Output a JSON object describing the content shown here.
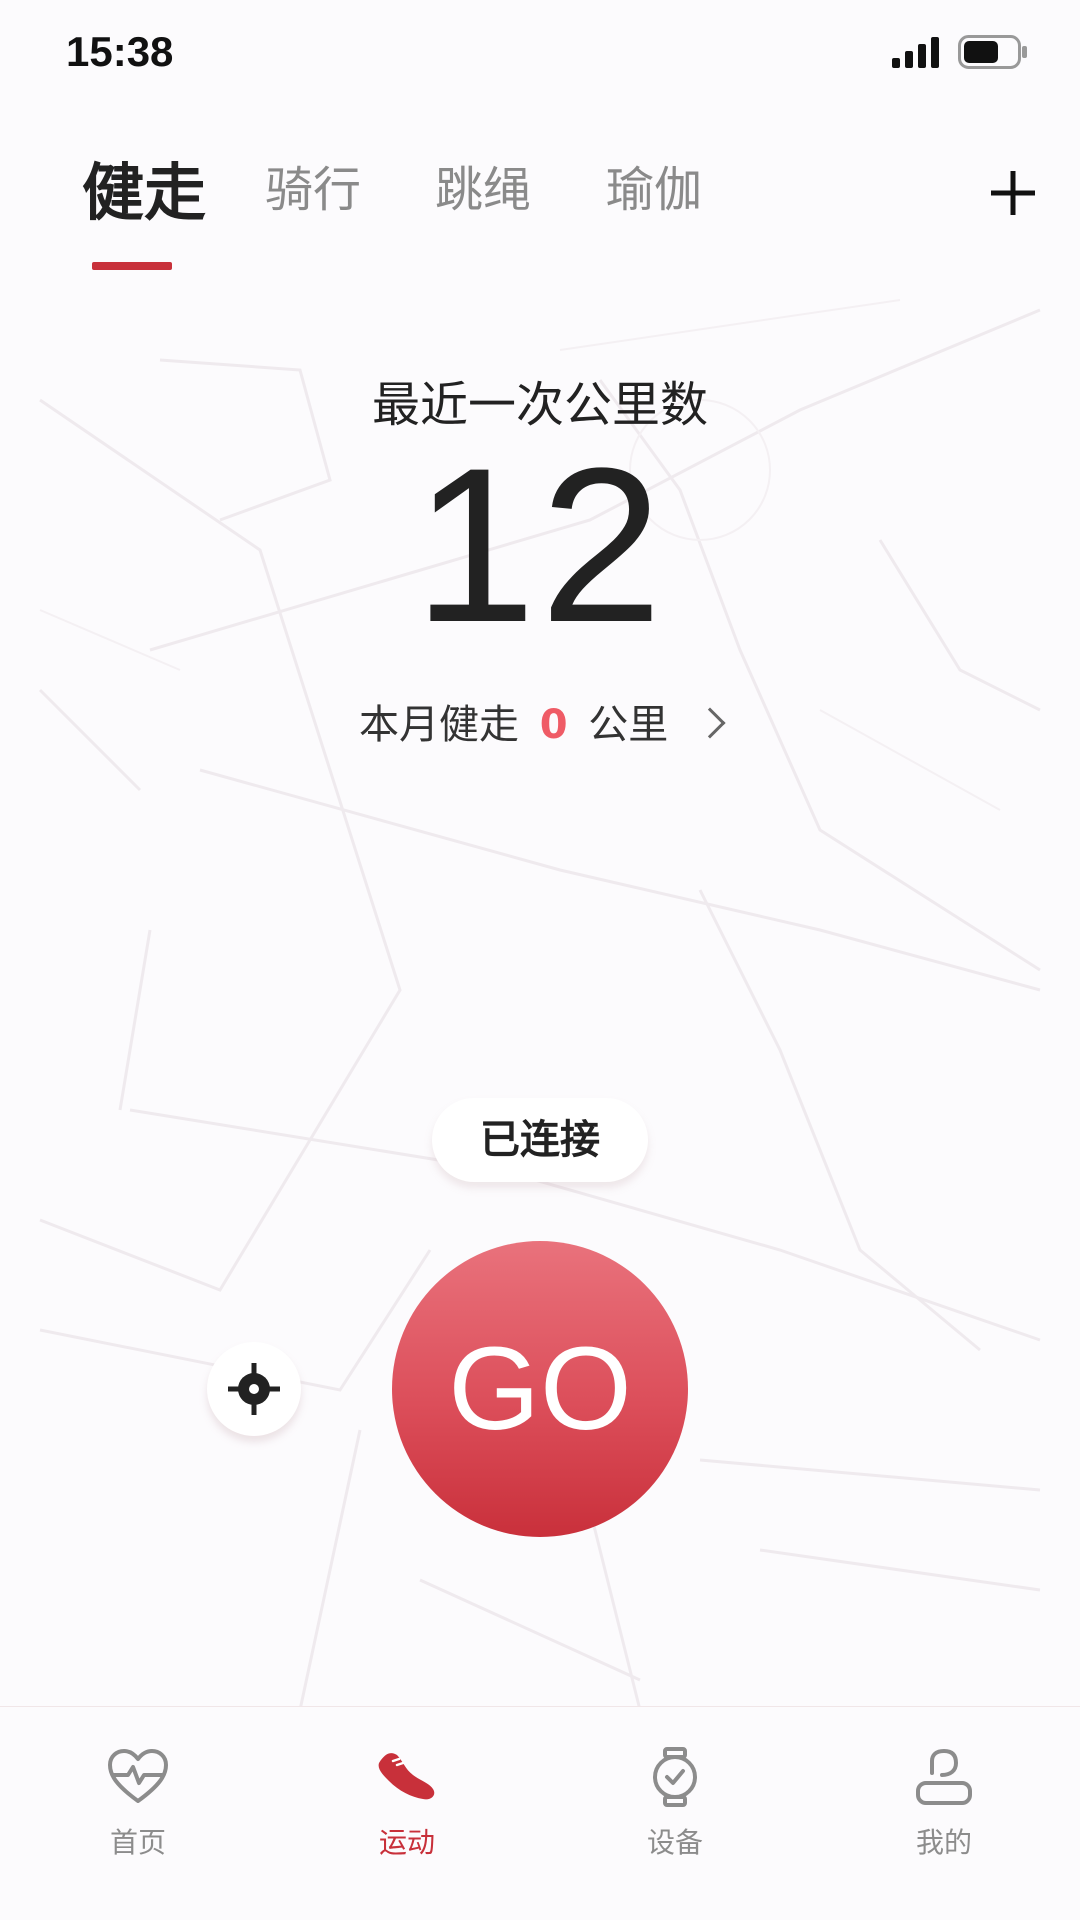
{
  "status_bar": {
    "time": "15:38"
  },
  "tabs": [
    {
      "label": "健走",
      "active": true
    },
    {
      "label": "骑行",
      "active": false
    },
    {
      "label": "跳绳",
      "active": false
    },
    {
      "label": "瑜伽",
      "active": false
    }
  ],
  "add_icon": "plus-icon",
  "summary": {
    "title": "最近一次公里数",
    "value": "12",
    "month_prefix": "本月健走",
    "month_value": "0",
    "month_unit": "公里"
  },
  "connection": {
    "status": "已连接"
  },
  "go_button": {
    "label": "GO"
  },
  "bottom_nav": [
    {
      "label": "首页",
      "icon": "heart-pulse-icon",
      "active": false
    },
    {
      "label": "运动",
      "icon": "shoe-icon",
      "active": true
    },
    {
      "label": "设备",
      "icon": "watch-icon",
      "active": false
    },
    {
      "label": "我的",
      "icon": "person-icon",
      "active": false
    }
  ],
  "colors": {
    "accent": "#c8303a",
    "go_gradient_top": "#e9727c",
    "go_gradient_bottom": "#c9303b",
    "highlight_number": "#ef5b66"
  }
}
